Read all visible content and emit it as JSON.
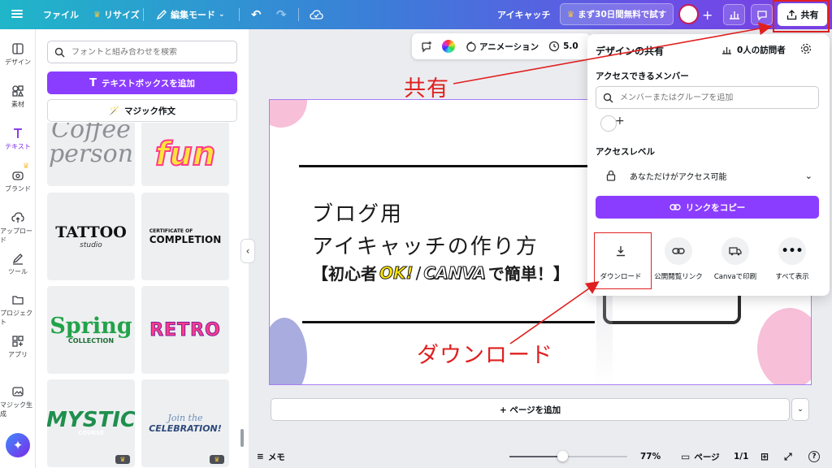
{
  "topbar": {
    "file": "ファイル",
    "resize": "リサイズ",
    "edit_mode": "編集モード",
    "doc_title": "アイキャッチ",
    "trial": "まず30日間無料で試す",
    "share": "共有"
  },
  "rail": [
    {
      "label": "デザイン",
      "icon": "layout-icon"
    },
    {
      "label": "素材",
      "icon": "elements-icon"
    },
    {
      "label": "テキスト",
      "icon": "text-icon"
    },
    {
      "label": "ブランド",
      "icon": "brand-icon"
    },
    {
      "label": "アップロード",
      "icon": "upload-icon"
    },
    {
      "label": "ツール",
      "icon": "draw-icon"
    },
    {
      "label": "プロジェクト",
      "icon": "folder-icon"
    },
    {
      "label": "アプリ",
      "icon": "apps-icon"
    },
    {
      "label": "マジック生成",
      "icon": "magic-media-icon"
    }
  ],
  "panel": {
    "search_placeholder": "フォントと組み合わせを検索",
    "add_textbox": "テキストボックスを追加",
    "magic_write": "マジック作文",
    "tiles": [
      {
        "line1": "Coffee",
        "line2": "person"
      },
      {
        "line1": "fun",
        "line2": ""
      },
      {
        "line1": "TATTOO",
        "line2": "studio"
      },
      {
        "line1": "CERTIFICATE OF",
        "line2": "COMPLETION"
      },
      {
        "line1": "Spring",
        "line2": "COLLECTION"
      },
      {
        "line1": "RETRO",
        "line2": ""
      },
      {
        "line1": "MYSTIC",
        "line2": "COURSE"
      },
      {
        "line1": "Join the",
        "line2": "CELEBRATION!"
      }
    ]
  },
  "context_bar": {
    "animation": "アニメーション",
    "time": "5.0"
  },
  "page": {
    "line1": "ブログ用",
    "line2": "アイキャッチの作り方",
    "line3_open": "【初心者",
    "line3_ok": "OK!",
    "line3_slash": "/",
    "line3_canva": "CANVA",
    "line3_close": "で簡単！】"
  },
  "add_page": "+ ページを追加",
  "bottombar": {
    "notes": "メモ",
    "zoom": "77%",
    "zoom_fraction": 0.45,
    "pages": "ページ",
    "page_count": "1/1"
  },
  "share_popover": {
    "title": "デザインの共有",
    "visitors": "0人の訪問者",
    "members_heading": "アクセスできるメンバー",
    "member_search_placeholder": "メンバーまたはグループを追加",
    "access_level_heading": "アクセスレベル",
    "access_level_value": "あなただけがアクセス可能",
    "copy_link": "リンクをコピー",
    "options": [
      {
        "label": "ダウンロード",
        "icon": "download-icon"
      },
      {
        "label": "公開閲覧リンク",
        "icon": "link-icon"
      },
      {
        "label": "Canvaで印刷",
        "icon": "truck-icon"
      },
      {
        "label": "すべて表示",
        "icon": "more-icon"
      }
    ]
  },
  "annotations": {
    "share": "共有",
    "download": "ダウンロード"
  },
  "colors": {
    "accent": "#8b3dff",
    "annotation": "#e02020"
  }
}
